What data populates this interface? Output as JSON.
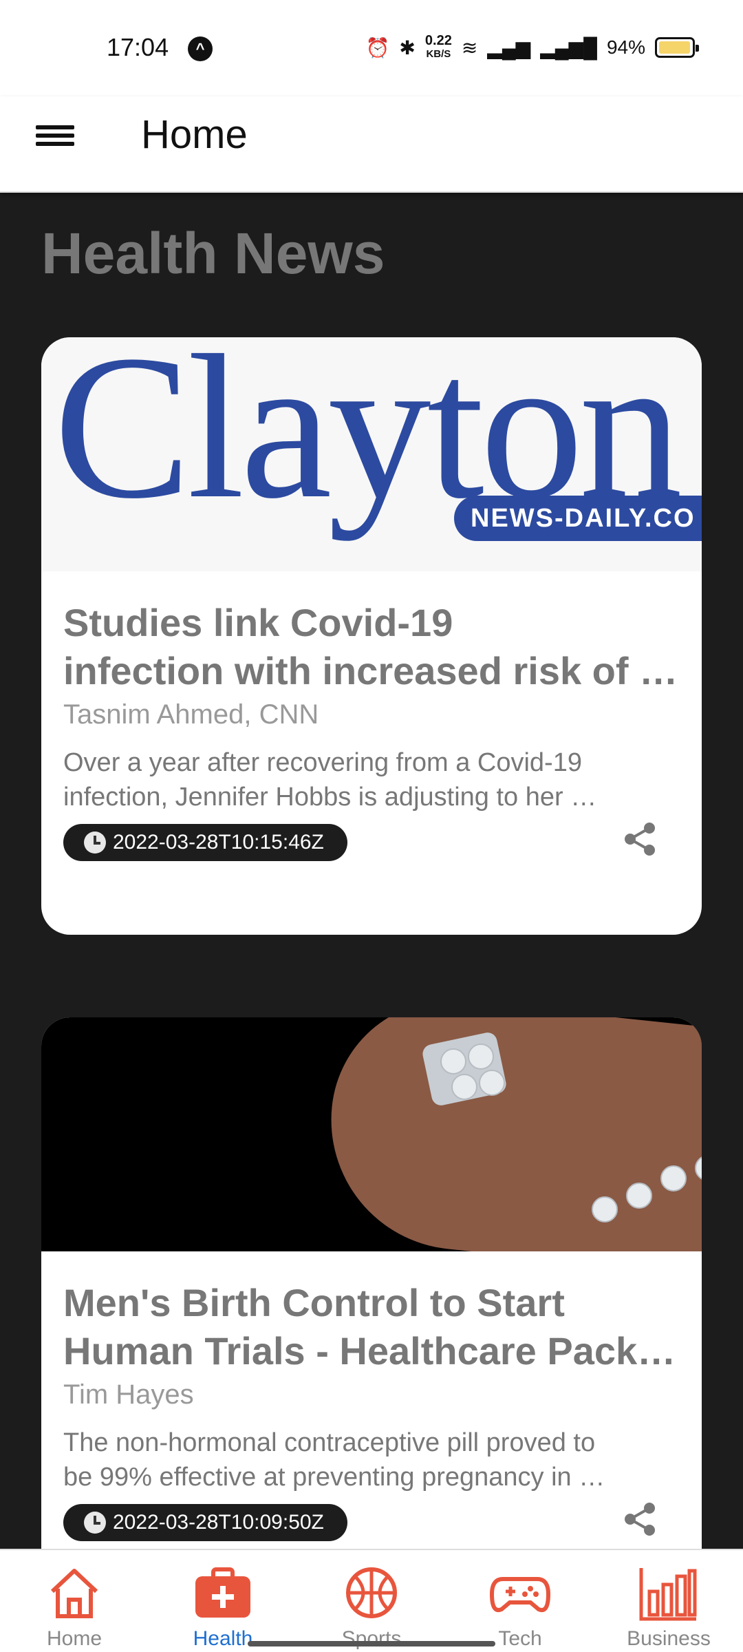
{
  "status_bar": {
    "time": "17:04",
    "speed_top": "0.22",
    "speed_unit": "KB/S",
    "battery": "94%"
  },
  "app_bar": {
    "title": "Home",
    "menu_icon": "hamburger-menu-icon"
  },
  "section_title": "Health News",
  "articles": [
    {
      "image_text_main": "Clayton",
      "image_text_sub": "NEWS-DAILY.CO",
      "headline_line1": "Studies link Covid-19",
      "headline_line2": "infection with increased risk of n…",
      "author": "Tasnim Ahmed, CNN",
      "desc_line1": "Over a year after recovering from a Covid-19",
      "desc_line2": "infection, Jennifer Hobbs is adjusting to her …",
      "date": "2022-03-28T10:15:46Z"
    },
    {
      "headline_line1": "Men's Birth Control to Start",
      "headline_line2": "Human Trials - Healthcare Packa…",
      "author": "Tim Hayes",
      "desc_line1": "The non-hormonal contraceptive pill proved to",
      "desc_line2": "be 99% effective at preventing pregnancy in …",
      "date": "2022-03-28T10:09:50Z"
    }
  ],
  "bottom_nav": [
    {
      "label": "Home",
      "icon": "home-icon"
    },
    {
      "label": "Health",
      "icon": "health-icon",
      "active": true
    },
    {
      "label": "Sports",
      "icon": "basketball-icon"
    },
    {
      "label": "Tech",
      "icon": "gamepad-icon"
    },
    {
      "label": "Business",
      "icon": "bar-chart-icon"
    }
  ],
  "colors": {
    "accent": "#e8553d",
    "active_label": "#1f6fd1",
    "background": "#1c1c1c",
    "brand_blue": "#2c4aa0"
  }
}
